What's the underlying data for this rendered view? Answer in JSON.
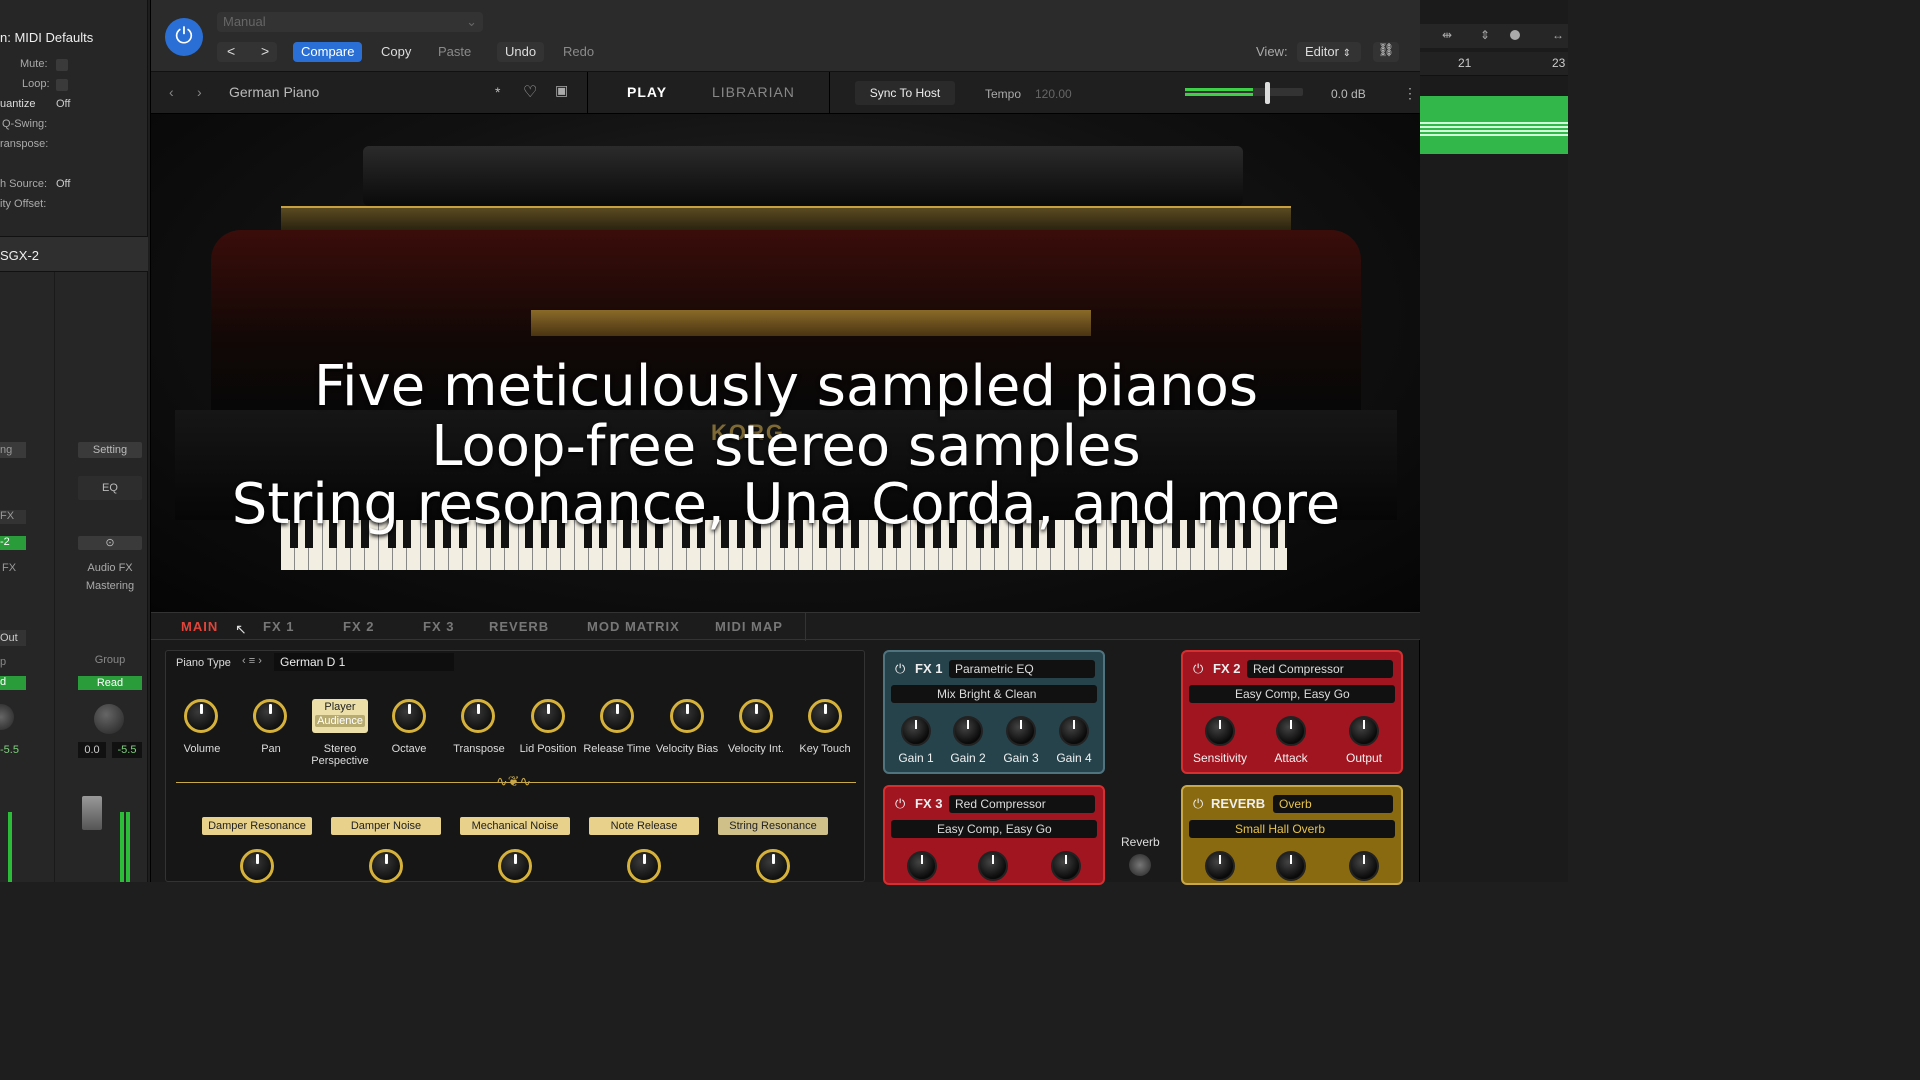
{
  "left_panel": {
    "title": "n: MIDI Defaults",
    "rows": [
      {
        "label": "Mute:"
      },
      {
        "label": "Loop:"
      },
      {
        "label": "uantize",
        "value": "Off"
      },
      {
        "label": "Q-Swing:"
      },
      {
        "label": "ranspose:"
      },
      {
        "label": "h Source:",
        "value": "Off"
      },
      {
        "label": "ity Offset:"
      }
    ],
    "track": "SGX-2",
    "setting": "Setting",
    "eq": "EQ",
    "audio_fx": "Audio FX",
    "mastering": "Mastering",
    "group": "Group",
    "read": "Read",
    "val_a": "0.0",
    "val_b": "-5.5",
    "val_c": "-5.5",
    "out": "Out",
    "fx": "FX",
    "fx2": "FX",
    "two": "-2",
    "d": "d",
    "ng": "ng",
    "p": "p"
  },
  "header": {
    "preset_dropdown": "Manual",
    "compare": "Compare",
    "copy": "Copy",
    "paste": "Paste",
    "undo": "Undo",
    "redo": "Redo",
    "view_label": "View:",
    "view_value": "Editor"
  },
  "bar2": {
    "preset_name": "German Piano",
    "modified": "*",
    "tab_play": "PLAY",
    "tab_librarian": "LIBRARIAN",
    "sync": "Sync To Host",
    "tempo_label": "Tempo",
    "tempo_value": "120.00",
    "level": "0.0 dB"
  },
  "right_panel": {
    "bar21": "21",
    "bar23": "23"
  },
  "overlay": {
    "line1": "Five meticulously sampled pianos",
    "line2": "Loop-free stereo samples",
    "line3": "String resonance, Una Corda, and more"
  },
  "tabs": [
    "MAIN",
    "FX 1",
    "FX 2",
    "FX 3",
    "REVERB",
    "MOD MATRIX",
    "MIDI MAP"
  ],
  "main": {
    "piano_type_label": "Piano Type",
    "piano_type_value": "German D 1",
    "knobs": [
      "Volume",
      "Pan",
      "Stereo Perspective",
      "Octave",
      "Transpose",
      "Lid Position",
      "Release Time",
      "Velocity Bias",
      "Velocity Int.",
      "Key Touch"
    ],
    "player": "Player",
    "audience": "Audience",
    "noise": [
      "Damper Resonance",
      "Damper Noise",
      "Mechanical Noise",
      "Note Release",
      "String Resonance"
    ]
  },
  "fx1": {
    "label": "FX 1",
    "type": "Parametric EQ",
    "preset": "Mix Bright & Clean",
    "knobs": [
      "Gain 1",
      "Gain 2",
      "Gain 3",
      "Gain 4"
    ]
  },
  "fx2": {
    "label": "FX 2",
    "type": "Red Compressor",
    "preset": "Easy Comp, Easy Go",
    "knobs": [
      "Sensitivity",
      "Attack",
      "Output"
    ]
  },
  "fx3": {
    "label": "FX 3",
    "type": "Red Compressor",
    "preset": "Easy Comp, Easy Go"
  },
  "reverb": {
    "label": "REVERB",
    "type": "Overb",
    "preset": "Small Hall Overb",
    "knob": "Reverb"
  },
  "colors": {
    "accent": "#2a6fd6",
    "active_tab": "#e0443a",
    "knob_ring": "#d6b23a",
    "fx_red": "#a01520",
    "fx_blue": "#26434c"
  }
}
